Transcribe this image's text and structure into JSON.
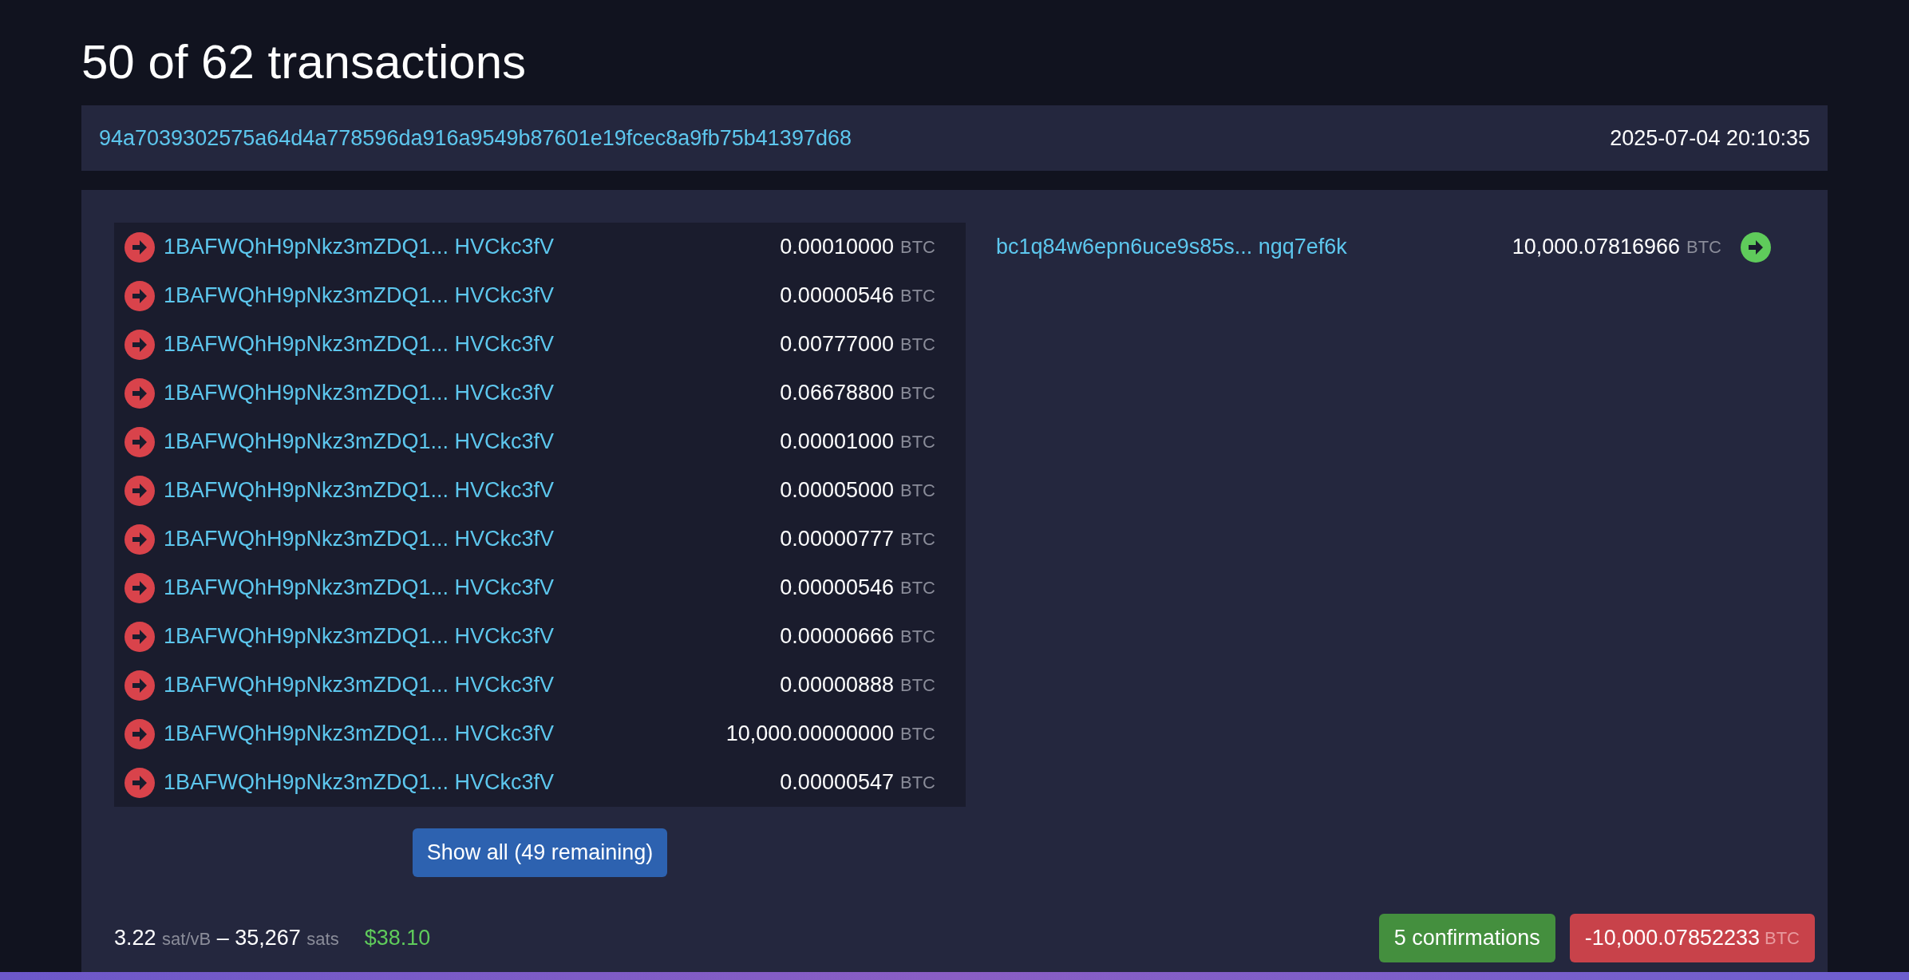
{
  "title": "50 of 62 transactions",
  "transaction": {
    "txid": "94a7039302575a64d4a778596da916a9549b87601e19fcec8a9fb75b41397d68",
    "time": "2025-07-04 20:10:35"
  },
  "inputs": [
    {
      "address": "1BAFWQhH9pNkz3mZDQ1... HVCkc3fV",
      "amount": "0.00010000",
      "unit": "BTC"
    },
    {
      "address": "1BAFWQhH9pNkz3mZDQ1... HVCkc3fV",
      "amount": "0.00000546",
      "unit": "BTC"
    },
    {
      "address": "1BAFWQhH9pNkz3mZDQ1... HVCkc3fV",
      "amount": "0.00777000",
      "unit": "BTC"
    },
    {
      "address": "1BAFWQhH9pNkz3mZDQ1... HVCkc3fV",
      "amount": "0.06678800",
      "unit": "BTC"
    },
    {
      "address": "1BAFWQhH9pNkz3mZDQ1... HVCkc3fV",
      "amount": "0.00001000",
      "unit": "BTC"
    },
    {
      "address": "1BAFWQhH9pNkz3mZDQ1... HVCkc3fV",
      "amount": "0.00005000",
      "unit": "BTC"
    },
    {
      "address": "1BAFWQhH9pNkz3mZDQ1... HVCkc3fV",
      "amount": "0.00000777",
      "unit": "BTC"
    },
    {
      "address": "1BAFWQhH9pNkz3mZDQ1... HVCkc3fV",
      "amount": "0.00000546",
      "unit": "BTC"
    },
    {
      "address": "1BAFWQhH9pNkz3mZDQ1... HVCkc3fV",
      "amount": "0.00000666",
      "unit": "BTC"
    },
    {
      "address": "1BAFWQhH9pNkz3mZDQ1... HVCkc3fV",
      "amount": "0.00000888",
      "unit": "BTC"
    },
    {
      "address": "1BAFWQhH9pNkz3mZDQ1... HVCkc3fV",
      "amount": "10,000.00000000",
      "unit": "BTC"
    },
    {
      "address": "1BAFWQhH9pNkz3mZDQ1... HVCkc3fV",
      "amount": "0.00000547",
      "unit": "BTC"
    }
  ],
  "outputs": [
    {
      "address": "bc1q84w6epn6uce9s85s... ngq7ef6k",
      "amount": "10,000.07816966",
      "unit": "BTC"
    }
  ],
  "show_all_button": "Show all (49 remaining)",
  "fee": {
    "rate": "3.22",
    "rate_unit": "sat/vB",
    "separator": "–",
    "sats": "35,267",
    "sats_unit": "sats",
    "usd": "$38.10"
  },
  "confirmations": "5 confirmations",
  "total": {
    "amount": "-10,000.07852233",
    "unit": "BTC"
  }
}
